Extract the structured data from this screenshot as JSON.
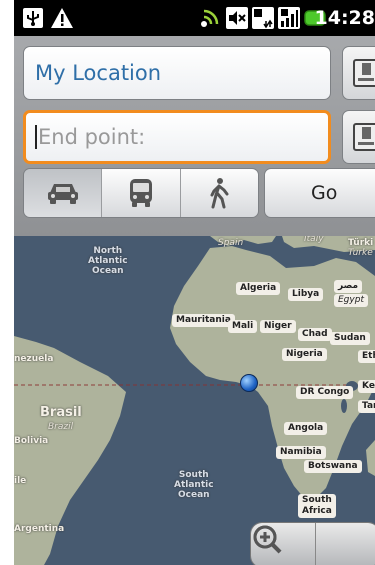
{
  "status_bar": {
    "time": "14:28",
    "icons": [
      "usb-icon",
      "warning-icon",
      "wifi-icon",
      "mute-icon",
      "data-icon",
      "signal-icon",
      "battery-icon"
    ]
  },
  "directions": {
    "start_value": "My Location",
    "end_placeholder": "End point:",
    "modes": [
      {
        "name": "car",
        "icon": "car-icon",
        "selected": true
      },
      {
        "name": "transit",
        "icon": "bus-icon",
        "selected": false
      },
      {
        "name": "walking",
        "icon": "walking-icon",
        "selected": false
      }
    ],
    "go_label": "Go"
  },
  "map": {
    "labels": {
      "spain": "Spain",
      "italy": "Italy",
      "turkey": "Türki",
      "turkey2": "Turke",
      "north_atlantic": "North\nAtlantic\nOcean",
      "algeria": "Algeria",
      "libya": "Libya",
      "egypt_ar": "مصر",
      "egypt": "Egypt",
      "mauritania": "Mauritania",
      "mali": "Mali",
      "niger": "Niger",
      "chad": "Chad",
      "sudan": "Sudan",
      "ethiopia": "Eth",
      "venezuela": "nezuela",
      "nigeria": "Nigeria",
      "kenya": "Ken",
      "dr_congo": "DR Congo",
      "tanzania": "Tanz",
      "brasil": "Brasil",
      "brazil": "Brazil",
      "bolivia": "Bolivia",
      "angola": "Angola",
      "namibia": "Namibia",
      "botswana": "Botswana",
      "chile": "ile",
      "south_atlantic": "South\nAtlantic\nOcean",
      "south_africa": "South\nAfrica",
      "argentina": "Argentina"
    },
    "colors": {
      "ocean": "#475a70",
      "land": "#aeb39c",
      "accent": "#f28c1e"
    }
  }
}
